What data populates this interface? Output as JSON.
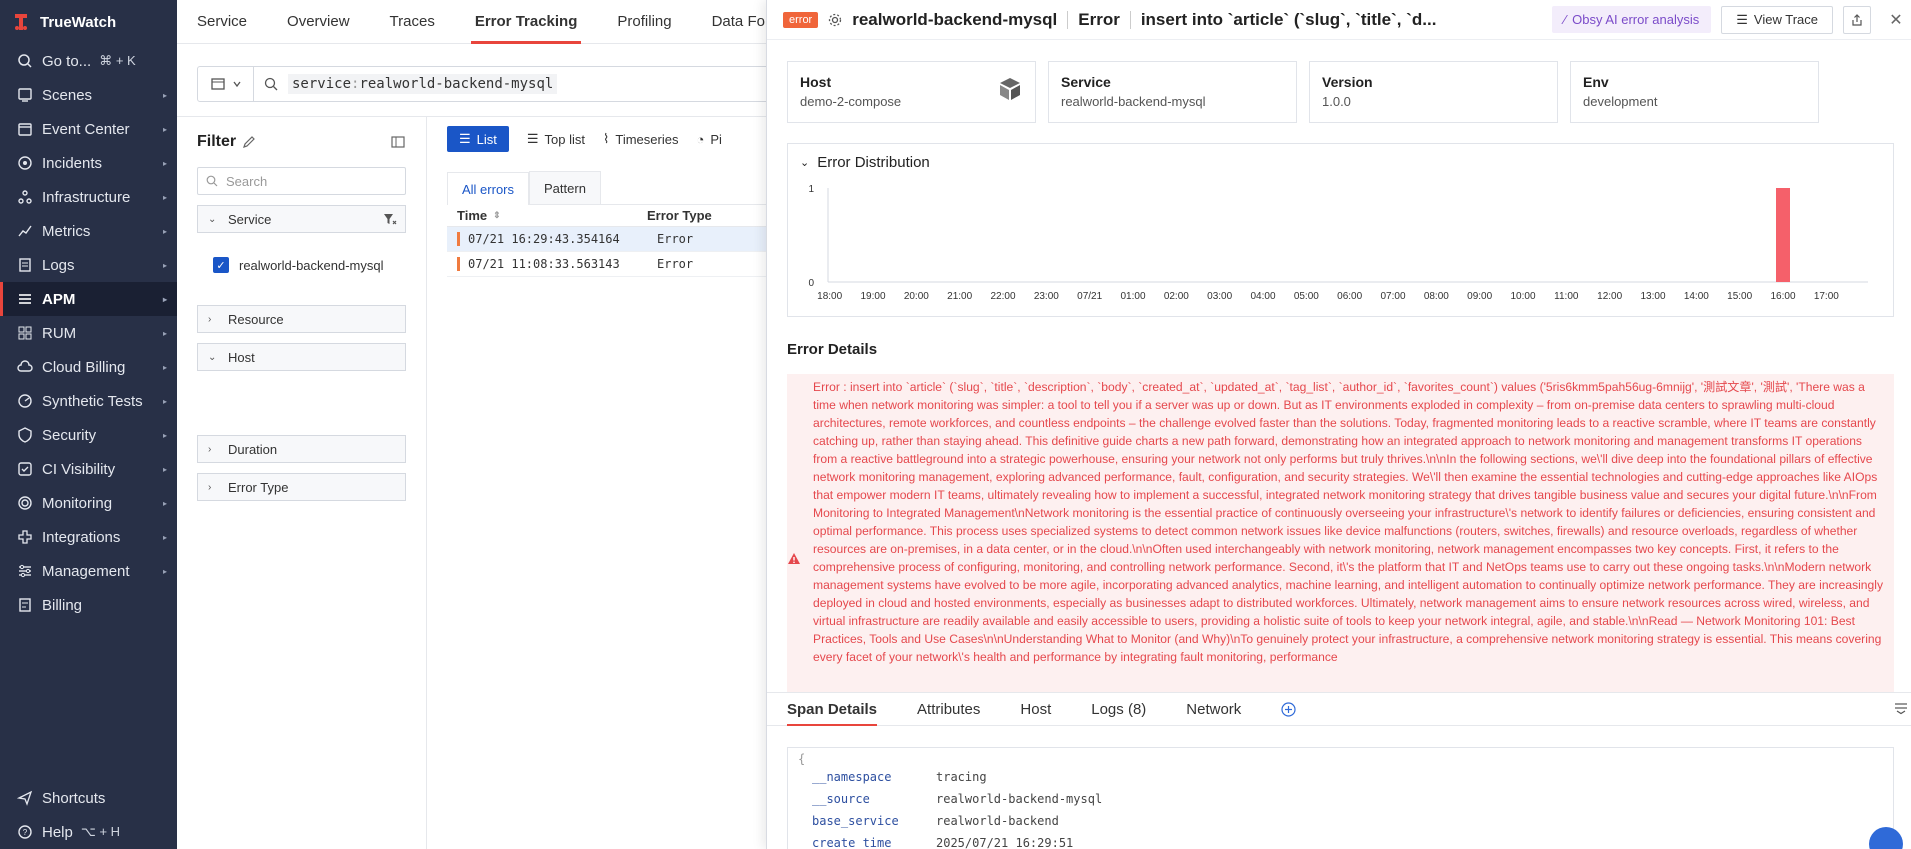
{
  "brand": {
    "name": "TrueWatch"
  },
  "sidebar": {
    "goto_label": "Go to...",
    "goto_shortcut": "⌘ + K",
    "items": [
      {
        "label": "Scenes"
      },
      {
        "label": "Event Center"
      },
      {
        "label": "Incidents"
      },
      {
        "label": "Infrastructure"
      },
      {
        "label": "Metrics"
      },
      {
        "label": "Logs"
      },
      {
        "label": "APM"
      },
      {
        "label": "RUM"
      },
      {
        "label": "Cloud Billing"
      },
      {
        "label": "Synthetic Tests"
      },
      {
        "label": "Security"
      },
      {
        "label": "CI Visibility"
      },
      {
        "label": "Monitoring"
      },
      {
        "label": "Integrations"
      },
      {
        "label": "Management"
      },
      {
        "label": "Billing"
      }
    ],
    "shortcuts_label": "Shortcuts",
    "help_label": "Help",
    "help_shortcut": "⌥ + H"
  },
  "top_tabs": [
    "Service",
    "Overview",
    "Traces",
    "Error Tracking",
    "Profiling",
    "Data For"
  ],
  "search": {
    "key": "service",
    "colon": ":",
    "value": "realworld-backend-mysql"
  },
  "filter": {
    "title": "Filter",
    "search_placeholder": "Search",
    "facets": {
      "service": "Service",
      "service_value": "realworld-backend-mysql",
      "resource": "Resource",
      "host": "Host",
      "duration": "Duration",
      "error_type": "Error Type"
    }
  },
  "list": {
    "view_tabs": {
      "list": "List",
      "toplist": "Top list",
      "timeseries": "Timeseries",
      "pie": "Pi"
    },
    "sub_tabs": {
      "all": "All errors",
      "pattern": "Pattern"
    },
    "columns": {
      "time": "Time",
      "type": "Error Type"
    },
    "rows": [
      {
        "time": "07/21 16:29:43.354164",
        "type": "Error"
      },
      {
        "time": "07/21 11:08:33.563143",
        "type": "Error"
      }
    ]
  },
  "drawer": {
    "badge": "error",
    "service": "realworld-backend-mysql",
    "kind": "Error",
    "title": "insert into `article` (`slug`, `title`, `d...",
    "ai_button": "Obsy AI error analysis",
    "trace_button": "View Trace",
    "cards": [
      {
        "label": "Host",
        "value": "demo-2-compose"
      },
      {
        "label": "Service",
        "value": "realworld-backend-mysql"
      },
      {
        "label": "Version",
        "value": "1.0.0"
      },
      {
        "label": "Env",
        "value": "development"
      }
    ],
    "distribution_title": "Error Distribution",
    "details_title": "Error Details",
    "error_message": "Error : insert into `article` (`slug`, `title`, `description`, `body`, `created_at`, `updated_at`, `tag_list`, `author_id`, `favorites_count`) values ('5ris6kmm5pah56ug-6mnijg', '測試文章', '測試', 'There was a time when network monitoring was simpler: a tool to tell you if a server was up or down. But as IT environments exploded in complexity – from on-premise data centers to sprawling multi-cloud architectures, remote workforces, and countless endpoints – the challenge evolved faster than the solutions. Today, fragmented monitoring leads to a reactive scramble, where IT teams are constantly catching up, rather than staying ahead. This definitive guide charts a new path forward, demonstrating how an integrated approach to network monitoring and management transforms IT operations from a reactive battleground into a strategic powerhouse, ensuring your network not only performs but truly thrives.\\n\\nIn the following sections, we\\'ll dive deep into the foundational pillars of effective network monitoring management, exploring advanced performance, fault, configuration, and security strategies. We\\'ll then examine the essential technologies and cutting-edge approaches like AIOps that empower modern IT teams, ultimately revealing how to implement a successful, integrated network monitoring strategy that drives tangible business value and secures your digital future.\\n\\nFrom Monitoring to Integrated Management\\nNetwork monitoring is the essential practice of continuously overseeing your infrastructure\\'s network to identify failures or deficiencies, ensuring consistent and optimal performance. This process uses specialized systems to detect common network issues like device malfunctions (routers, switches, firewalls) and resource overloads, regardless of whether resources are on-premises, in a data center, or in the cloud.\\n\\nOften used interchangeably with network monitoring, network management encompasses two key concepts. First, it refers to the comprehensive process of configuring, monitoring, and controlling network performance. Second, it\\'s the platform that IT and NetOps teams use to carry out these ongoing tasks.\\n\\nModern network management systems have evolved to be more agile, incorporating advanced analytics, machine learning, and intelligent automation to continually optimize network performance. They are increasingly deployed in cloud and hosted environments, especially as businesses adapt to distributed workforces. Ultimately, network management aims to ensure network resources across wired, wireless, and virtual infrastructure are readily available and easily accessible to users, providing a holistic suite of tools to keep your network integral, agile, and stable.\\n\\nRead — Network Monitoring 101: Best Practices, Tools and Use Cases\\n\\nUnderstanding What to Monitor (and Why)\\nTo genuinely protect your infrastructure, a comprehensive network monitoring strategy is essential. This means covering every facet of your network\\'s health and performance by integrating fault monitoring, performance",
    "span_tabs": [
      "Span Details",
      "Attributes",
      "Host",
      "Logs (8)",
      "Network"
    ],
    "json_open": "{",
    "span_fields": [
      {
        "key": "__namespace",
        "value": "tracing"
      },
      {
        "key": "__source",
        "value": "realworld-backend-mysql"
      },
      {
        "key": "base_service",
        "value": "realworld-backend"
      },
      {
        "key": "create_time",
        "value": "2025/07/21 16:29:51"
      }
    ]
  },
  "chart_data": {
    "type": "bar",
    "title": "Error Distribution",
    "categories": [
      "18:00",
      "19:00",
      "20:00",
      "21:00",
      "22:00",
      "23:00",
      "07/21",
      "01:00",
      "02:00",
      "03:00",
      "04:00",
      "05:00",
      "06:00",
      "07:00",
      "08:00",
      "09:00",
      "10:00",
      "11:00",
      "12:00",
      "13:00",
      "14:00",
      "15:00",
      "16:00",
      "17:00"
    ],
    "values": [
      0,
      0,
      0,
      0,
      0,
      0,
      0,
      0,
      0,
      0,
      0,
      0,
      0,
      0,
      0,
      0,
      0,
      0,
      0,
      0,
      0,
      0,
      1,
      0
    ],
    "ylim": [
      0,
      1
    ],
    "y_ticks": [
      "0",
      "1"
    ],
    "color": "#f5606a"
  }
}
